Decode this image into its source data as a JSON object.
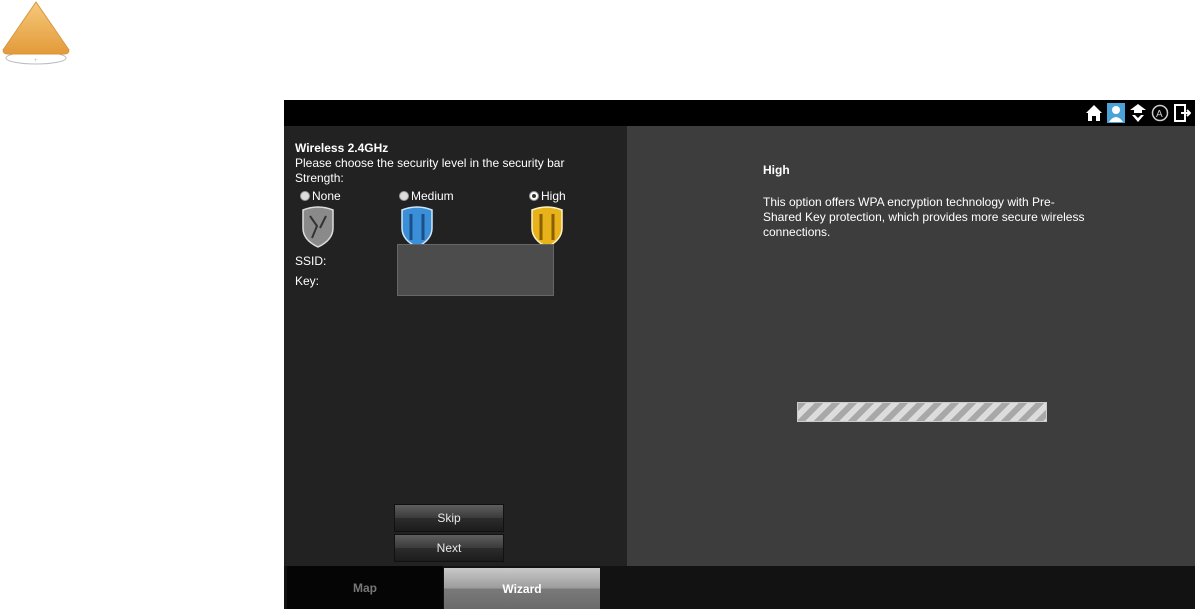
{
  "header_icons": [
    "home-icon",
    "user-icon",
    "upgrade-icon",
    "auto-update-icon",
    "logout-icon"
  ],
  "left": {
    "title": "Wireless 2.4GHz",
    "instruction": "Please choose the security level in the security bar",
    "strength_label": "Strength:",
    "options": [
      {
        "label": "None",
        "selected": false,
        "color": "#8a8a8a"
      },
      {
        "label": "Medium",
        "selected": false,
        "color": "#3b8fd8"
      },
      {
        "label": "High",
        "selected": true,
        "color": "#e7b21a"
      }
    ],
    "ssid_label": "SSID:",
    "key_label": "Key:",
    "skip_label": "Skip",
    "next_label": "Next"
  },
  "right": {
    "title": "High",
    "description": "This option offers WPA encryption technology with Pre-Shared Key protection, which provides more secure wireless connections."
  },
  "tabs": {
    "map": "Map",
    "wizard": "Wizard"
  }
}
